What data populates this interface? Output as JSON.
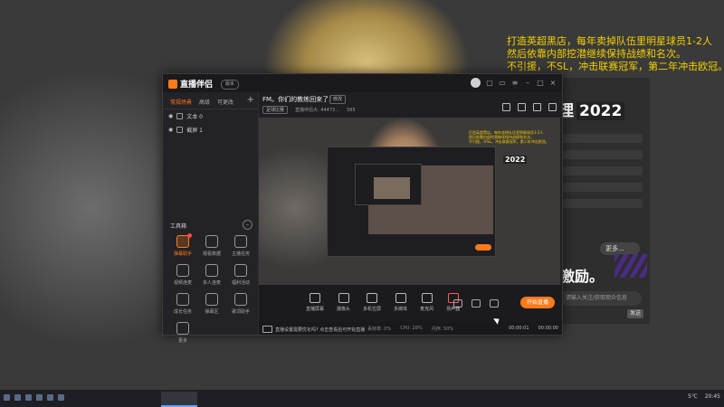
{
  "overlay": {
    "lines": [
      "打造英超黑店，每年卖掉队伍里明星球员1-2人",
      "然后依靠内部挖潜继续保持战绩和名次。",
      "不引援，不SL，冲击联赛冠军，第二年冲击欧冠。"
    ]
  },
  "right_app": {
    "title_prefix": "理",
    "title_year": "2022",
    "cta": "激励。",
    "select_label": "更多...",
    "input_placeholder": "请输入关注/获取观众信息",
    "button_label": "发送"
  },
  "app": {
    "name": "直播伴侣",
    "version": "版本",
    "source_tabs": [
      "常规场景",
      "高级",
      "可更改"
    ],
    "sources": [
      "文本 0",
      "截屏 1"
    ],
    "tools_title": "工具箱",
    "tools": [
      {
        "label": "弹幕助手",
        "active": true,
        "badge": true
      },
      {
        "label": "观看数据",
        "active": false,
        "badge": false
      },
      {
        "label": "主播任务",
        "active": false,
        "badge": false
      },
      {
        "label": "视频连麦",
        "active": false,
        "badge": false
      },
      {
        "label": "多人连麦",
        "active": false,
        "badge": false
      },
      {
        "label": "福利活动",
        "active": false,
        "badge": false
      },
      {
        "label": "成长任务",
        "active": false,
        "badge": false
      },
      {
        "label": "弹幕区",
        "active": false,
        "badge": false
      },
      {
        "label": "歌词助手",
        "active": false,
        "badge": false
      },
      {
        "label": "更多",
        "active": false,
        "badge": false
      }
    ],
    "bottom_tip": "直播设置已经持续...",
    "room_title": "FM。你们的教练回来了！",
    "edit_label": "修改",
    "room_tag": "足球比赛",
    "room_stats": [
      "直播伴侣大: 44473...",
      "585"
    ],
    "bottom_tools": [
      "直播屏幕",
      "摄像头",
      "多机位屏",
      "多媒体",
      "麦克风",
      "扬声器"
    ],
    "golive_label": "开始直播",
    "status": {
      "tip": "直播设置需要优化吗? 点击查看后可开始直播",
      "stats": [
        "丢帧率: 0%",
        "CPU: 28%",
        "内存: 50%"
      ],
      "timers": [
        "00:00:01",
        "00:00:00"
      ]
    }
  },
  "preview": {
    "overlay_lines": [
      "打造英超黑店，每年卖掉队伍里明星球员1-2人",
      "然后依靠内部挖潜继续保持战绩和名次。",
      "不引援，不SL，冲击联赛冠军，第二年冲击欧冠。"
    ],
    "year": "2022"
  },
  "taskbar": {
    "tray": [
      "5℃",
      "20:45"
    ]
  },
  "colors": {
    "accent": "#ff7a1a",
    "overlay_text": "#f4d100",
    "window_bg": "#1f1f23"
  }
}
